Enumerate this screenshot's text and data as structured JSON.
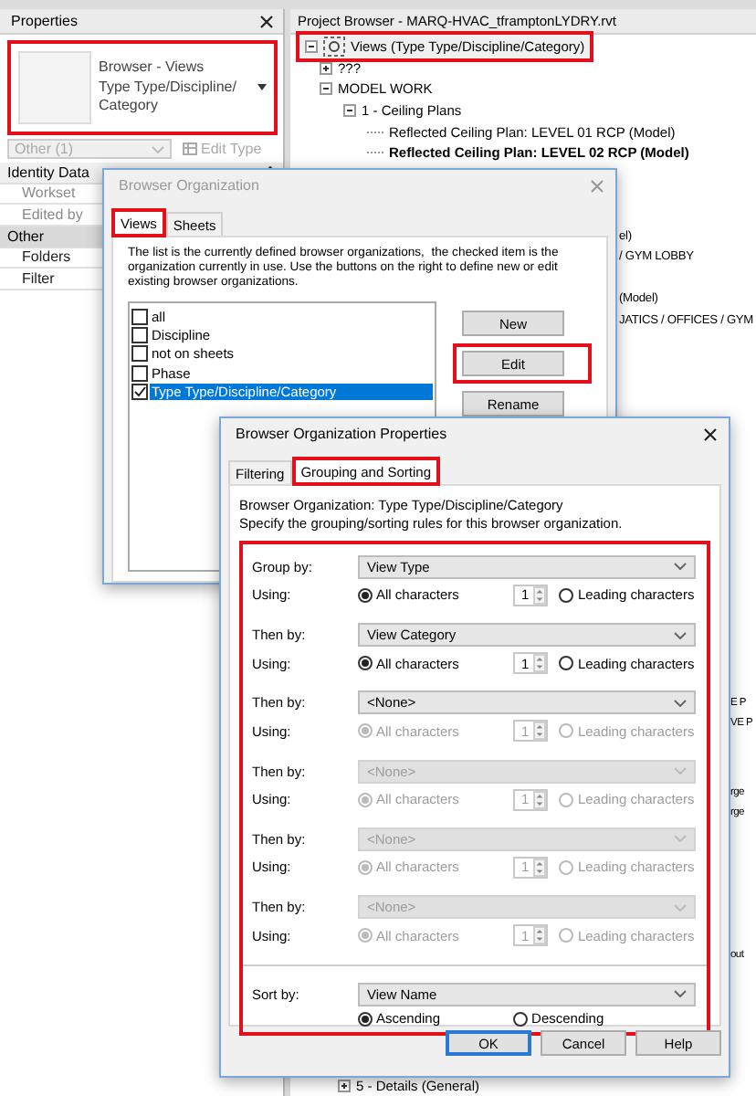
{
  "properties": {
    "title": "Properties",
    "preview": {
      "lines": [
        "Browser - Views",
        "Type Type/Discipline/",
        "Category"
      ],
      "highlighted": true
    },
    "type_selector": {
      "value": "Other (1)",
      "disabled": true
    },
    "edit_type": {
      "label": "Edit Type",
      "disabled": true
    },
    "groups": [
      {
        "label": "Identity Data",
        "expanded": true,
        "rows": [
          {
            "label": "Workset",
            "disabled": true
          },
          {
            "label": "Edited by",
            "disabled": true
          }
        ]
      },
      {
        "label": "Other",
        "expanded": true,
        "rows": [
          {
            "label": "Folders",
            "disabled": false
          },
          {
            "label": "Filter",
            "disabled": false
          }
        ]
      }
    ]
  },
  "browser": {
    "title": "Project Browser - MARQ-HVAC_tframptonLYDRY.rvt",
    "tree": [
      {
        "label": "Views (Type Type/Discipline/Category)",
        "expanded": true,
        "highlighted": true,
        "children": [
          {
            "label": "???",
            "expanded": false
          },
          {
            "label": "MODEL WORK",
            "expanded": true,
            "children": [
              {
                "label": "1 - Ceiling Plans",
                "expanded": true,
                "children": [
                  {
                    "label": "Reflected Ceiling Plan: LEVEL 01 RCP (Model)",
                    "active": false
                  },
                  {
                    "label": "Reflected Ceiling Plan: LEVEL 02 RCP (Model)",
                    "active": true
                  }
                ]
              }
            ]
          }
        ]
      }
    ],
    "covered_fragments": [
      "el)",
      "/ GYM LOBBY",
      "(Model)",
      "JATICS / OFFICES / GYM",
      "E P",
      "VE P",
      "rge",
      "rge",
      "out"
    ],
    "bottom_rows": [
      {
        "label": "5 - Details (General)",
        "expanded": false
      }
    ]
  },
  "browser_organization": {
    "title": "Browser Organization",
    "focused": false,
    "tabs": [
      {
        "label": "Views",
        "selected": true,
        "highlighted": true
      },
      {
        "label": "Sheets",
        "selected": false,
        "highlighted": false
      }
    ],
    "description": "The list is the currently defined browser organizations,  the checked item is the organization currently in use. Use the buttons on the right to define new or edit existing browser organizations.",
    "items": [
      {
        "label": "all",
        "checked": false,
        "selected": false
      },
      {
        "label": "Discipline",
        "checked": false,
        "selected": false
      },
      {
        "label": "not on sheets",
        "checked": false,
        "selected": false
      },
      {
        "label": "Phase",
        "checked": false,
        "selected": false
      },
      {
        "label": "Type Type/Discipline/Category",
        "checked": true,
        "selected": true
      }
    ],
    "buttons": [
      {
        "label": "New",
        "highlighted": false
      },
      {
        "label": "Edit",
        "highlighted": true
      },
      {
        "label": "Rename",
        "highlighted": false
      }
    ]
  },
  "organization_properties": {
    "title": "Browser Organization Properties",
    "focused": true,
    "tabs": [
      {
        "label": "Filtering",
        "selected": false,
        "highlighted": false
      },
      {
        "label": "Grouping and Sorting",
        "selected": true,
        "highlighted": true
      }
    ],
    "organization_line": "Browser Organization: Type Type/Discipline/Category",
    "instruction": "Specify the grouping/sorting rules for this browser organization.",
    "rules_highlighted": true,
    "rules": [
      {
        "label": "Group by:",
        "value": "View Type",
        "disabled": false,
        "using_label": "Using:",
        "using_disabled": false,
        "all_label": "All characters",
        "all_selected": true,
        "count": "1",
        "leading_label": "Leading characters",
        "leading_selected": false
      },
      {
        "label": "Then by:",
        "value": "View Category",
        "disabled": false,
        "using_label": "Using:",
        "using_disabled": false,
        "all_label": "All characters",
        "all_selected": true,
        "count": "1",
        "leading_label": "Leading characters",
        "leading_selected": false
      },
      {
        "label": "Then by:",
        "value": "<None>",
        "disabled": false,
        "using_label": "Using:",
        "using_disabled": true,
        "all_label": "All characters",
        "all_selected": true,
        "count": "1",
        "leading_label": "Leading characters",
        "leading_selected": false
      },
      {
        "label": "Then by:",
        "value": "<None>",
        "disabled": true,
        "using_label": "Using:",
        "using_disabled": true,
        "all_label": "All characters",
        "all_selected": true,
        "count": "1",
        "leading_label": "Leading characters",
        "leading_selected": false
      },
      {
        "label": "Then by:",
        "value": "<None>",
        "disabled": true,
        "using_label": "Using:",
        "using_disabled": true,
        "all_label": "All characters",
        "all_selected": true,
        "count": "1",
        "leading_label": "Leading characters",
        "leading_selected": false
      },
      {
        "label": "Then by:",
        "value": "<None>",
        "disabled": true,
        "using_label": "Using:",
        "using_disabled": true,
        "all_label": "All characters",
        "all_selected": true,
        "count": "1",
        "leading_label": "Leading characters",
        "leading_selected": false
      }
    ],
    "sort": {
      "label": "Sort by:",
      "value": "View Name",
      "options": [
        {
          "label": "Ascending",
          "selected": true
        },
        {
          "label": "Descending",
          "selected": false
        }
      ]
    },
    "buttons": [
      {
        "label": "OK",
        "default": true
      },
      {
        "label": "Cancel",
        "default": false
      },
      {
        "label": "Help",
        "default": false
      }
    ]
  }
}
